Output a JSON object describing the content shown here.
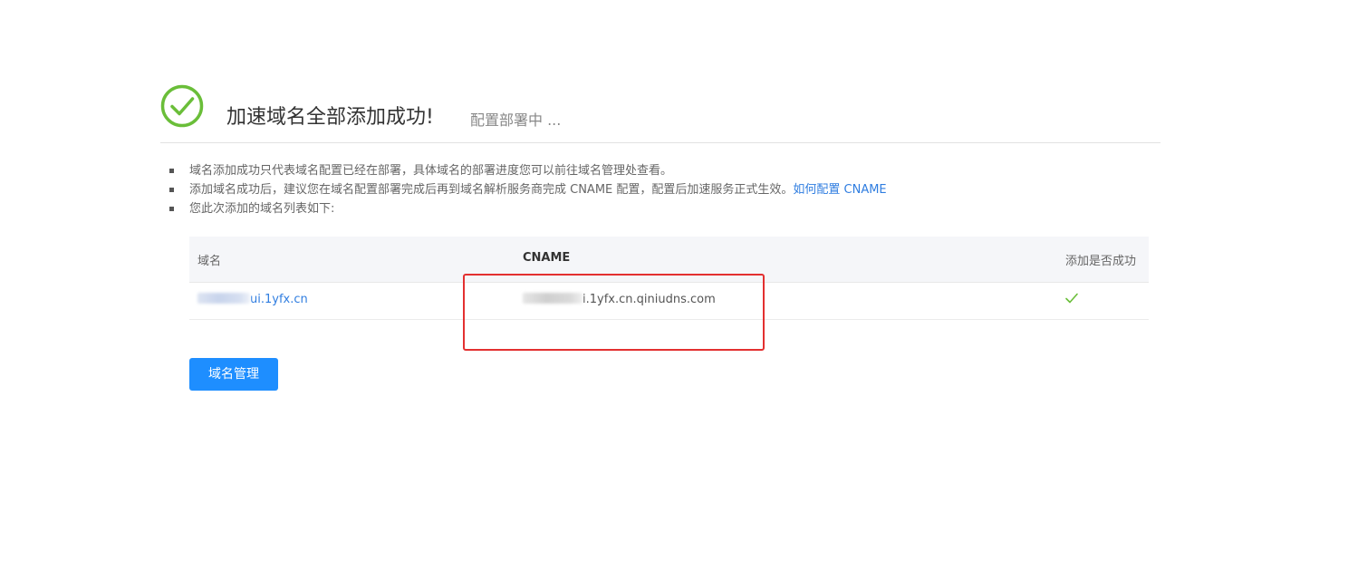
{
  "header": {
    "title": "加速域名全部添加成功!",
    "subtitle": "配置部署中 ...",
    "success_icon": "check-circle-icon",
    "success_color": "#6abe39"
  },
  "notes": [
    {
      "text": "域名添加成功只代表域名配置已经在部署，具体域名的部署进度您可以前往域名管理处查看。"
    },
    {
      "text": "添加域名成功后，建议您在域名配置部署完成后再到域名解析服务商完成 CNAME 配置，配置后加速服务正式生效。",
      "link": "如何配置 CNAME"
    },
    {
      "text": "您此次添加的域名列表如下:"
    }
  ],
  "table": {
    "headers": [
      "域名",
      "CNAME",
      "添加是否成功"
    ],
    "rows": [
      {
        "domain": "ui.1yfx.cn",
        "cname": "i.1yfx.cn.qiniudns.com",
        "success_icon": "check-icon"
      }
    ]
  },
  "button": {
    "label": "域名管理"
  },
  "colors": {
    "link": "#2f7de0",
    "primary": "#1e8eff",
    "annotation": "#e33030",
    "success": "#6abe39"
  }
}
